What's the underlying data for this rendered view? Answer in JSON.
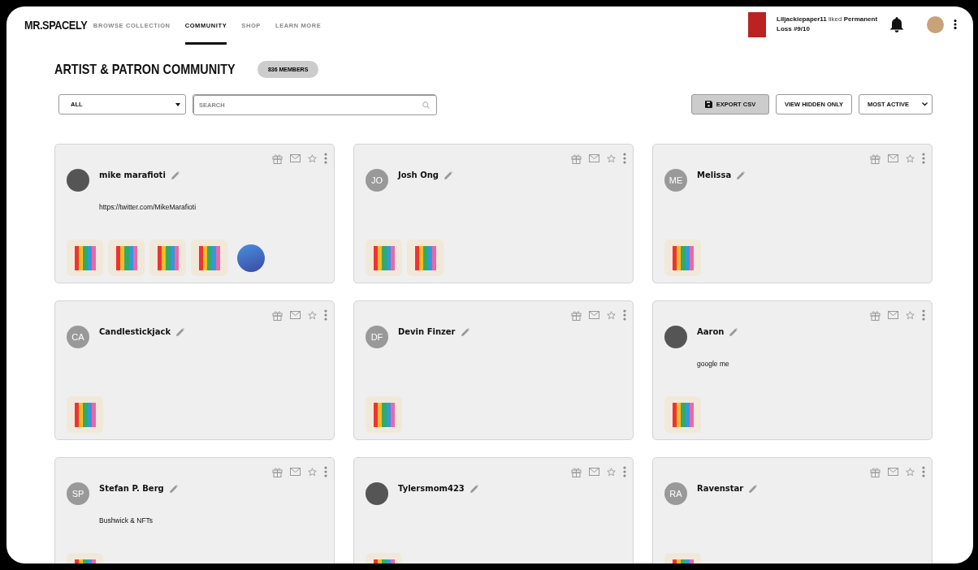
{
  "header": {
    "logo": "MR.SPACELY",
    "nav": [
      {
        "label": "BROWSE COLLECTION",
        "selected": false
      },
      {
        "label": "COMMUNITY",
        "selected": true
      },
      {
        "label": "SHOP",
        "selected": false
      },
      {
        "label": "LEARN MORE",
        "selected": false
      }
    ],
    "notification": {
      "text": "**Liljackiepaper11** liked **Permanent Loss #9/10**"
    }
  },
  "page": {
    "title": "ARTIST & PATRON COMMUNITY",
    "member_count": "836 MEMBERS"
  },
  "toolbar": {
    "filter": {
      "value": "ALL"
    },
    "search": {
      "placeholder": "SEARCH"
    },
    "export_button": "EXPORT CSV",
    "hidden_button": "VIEW HIDDEN ONLY",
    "sort": {
      "value": "MOST ACTIVE"
    }
  },
  "members": [
    {
      "name": "mike marafioti",
      "avatar": {
        "kind": "photo"
      },
      "bio": "https://twitter.com/MikeMarafioti",
      "artworks": [
        {
          "kind": "print"
        },
        {
          "kind": "print"
        },
        {
          "kind": "print"
        },
        {
          "kind": "print"
        },
        {
          "kind": "sphere"
        }
      ]
    },
    {
      "name": "Josh Ong",
      "avatar": {
        "kind": "initials",
        "initials": "JO"
      },
      "artworks": [
        {
          "kind": "print"
        },
        {
          "kind": "print"
        }
      ]
    },
    {
      "name": "Melissa",
      "avatar": {
        "kind": "initials",
        "initials": "ME"
      },
      "artworks": [
        {
          "kind": "print"
        }
      ]
    },
    {
      "name": "Candlestickjack",
      "avatar": {
        "kind": "initials",
        "initials": "CA"
      },
      "artworks": [
        {
          "kind": "print"
        }
      ]
    },
    {
      "name": "Devin Finzer",
      "avatar": {
        "kind": "initials",
        "initials": "DF"
      },
      "artworks": [
        {
          "kind": "print"
        }
      ]
    },
    {
      "name": "Aaron",
      "avatar": {
        "kind": "photo"
      },
      "bio": "google me",
      "artworks": [
        {
          "kind": "print"
        }
      ]
    },
    {
      "name": "Stefan P. Berg",
      "avatar": {
        "kind": "initials",
        "initials": "SP"
      },
      "bio": "Bushwick & NFTs",
      "artworks": [
        {
          "kind": "print"
        }
      ]
    },
    {
      "name": "Tylersmom423",
      "avatar": {
        "kind": "photo"
      },
      "artworks": [
        {
          "kind": "print"
        }
      ]
    },
    {
      "name": "Ravenstar",
      "avatar": {
        "kind": "initials",
        "initials": "RA"
      },
      "artworks": [
        {
          "kind": "print"
        }
      ]
    }
  ]
}
